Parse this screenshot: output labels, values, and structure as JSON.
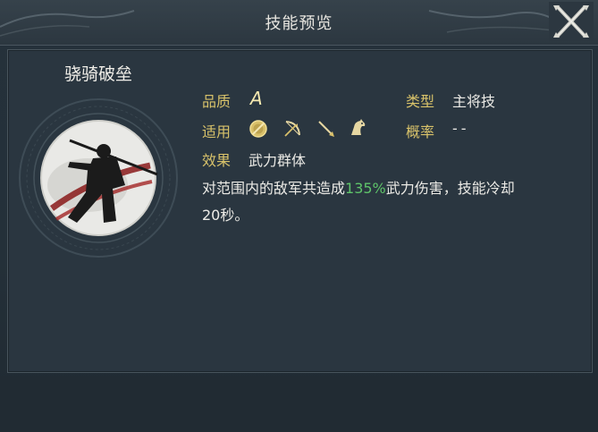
{
  "window": {
    "title": "技能预览",
    "close_icon": "close-x-icon"
  },
  "skill": {
    "name": "骁骑破垒",
    "quality_label": "品质",
    "quality_value": "A",
    "type_label": "类型",
    "type_value": "主将技",
    "applicable_label": "适用",
    "applicable_units": [
      "shield-icon",
      "bow-icon",
      "spear-icon",
      "cavalry-horse-icon"
    ],
    "probability_label": "概率",
    "probability_value": "--",
    "effect_label": "效果",
    "effect_value": "武力群体",
    "description_prefix": "对范围内的敌军共造成",
    "description_highlight": "135%",
    "description_suffix_line1": "武力伤害，技能冷却",
    "description_line2": "20秒。",
    "portrait_icon": "warrior-silhouette-icon"
  },
  "colors": {
    "label": "#d8c26a",
    "highlight": "#5fc46a",
    "text": "#ecebe6"
  }
}
